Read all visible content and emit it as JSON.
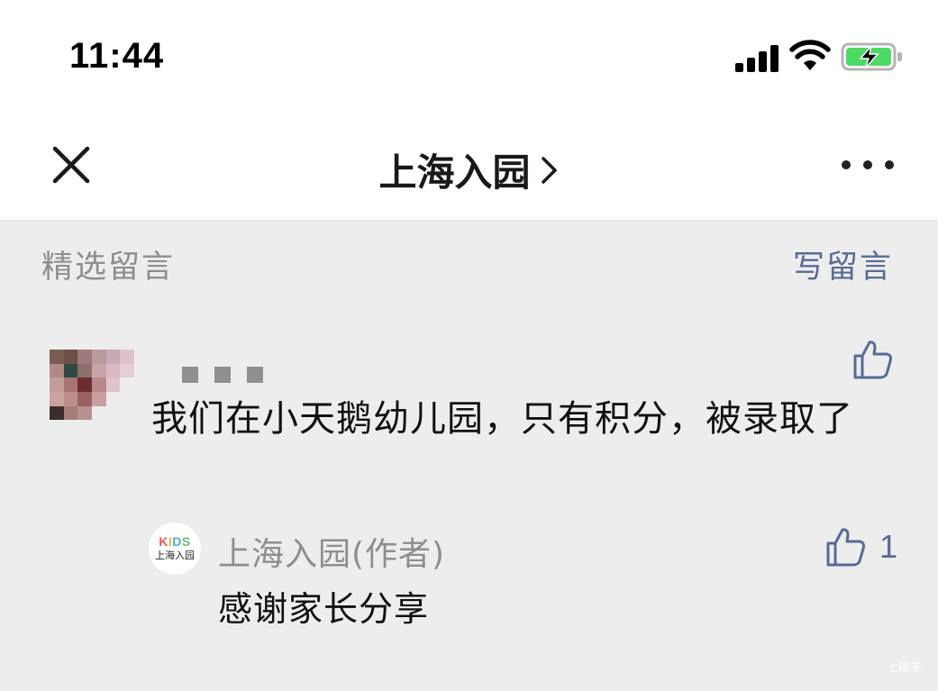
{
  "status_bar": {
    "time": "11:44",
    "icons": [
      "cellular-signal-icon",
      "wifi-icon",
      "battery-charging-icon"
    ],
    "battery_color": "#4cd964"
  },
  "nav": {
    "close_icon": "close-icon",
    "title": "上海入园",
    "title_icon": "chevron-right-icon",
    "more_icon": "more-dots-icon"
  },
  "section": {
    "title": "精选留言",
    "write_label": "写留言",
    "accent_color": "#576b95"
  },
  "comment": {
    "author_masked": true,
    "text": "我们在小天鹅幼儿园，只有积分，被录取了",
    "like_icon": "thumbs-up-icon",
    "reply": {
      "avatar_logo": "KIDS",
      "avatar_logo_caption": "上海入园",
      "author": "上海入园(作者)",
      "text": "感谢家长分享",
      "likes": "1"
    }
  },
  "watermark": "上眼学"
}
